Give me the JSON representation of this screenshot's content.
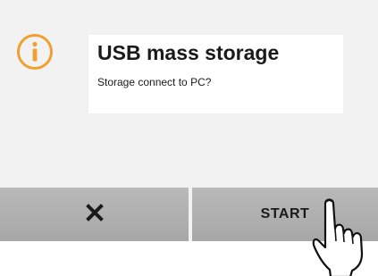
{
  "dialog": {
    "title": "USB mass storage",
    "message": "Storage connect to PC?"
  },
  "buttons": {
    "cancel_icon": "close-icon",
    "start_label": "START"
  },
  "colors": {
    "info_icon": "#f0a030",
    "panel": "#f2f2f2",
    "button": "#b0b0b0"
  }
}
